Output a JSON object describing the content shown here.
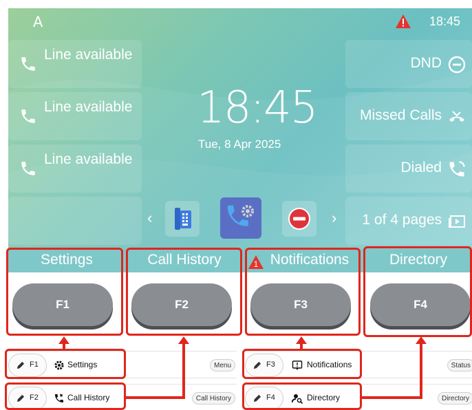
{
  "status_bar": {
    "account": "A",
    "time": "18:45",
    "alert_icon": "warning-triangle-icon"
  },
  "lines": [
    {
      "label": "Line available",
      "icon": "phone-icon"
    },
    {
      "label": "Line available",
      "icon": "phone-icon"
    },
    {
      "label": "Line available",
      "icon": "phone-icon"
    }
  ],
  "clock": {
    "time": "18:45",
    "date": "Tue, 8 Apr 2025"
  },
  "right_keys": [
    {
      "label": "DND",
      "icon": "dnd-circle-icon"
    },
    {
      "label": "Missed Calls",
      "icon": "missed-call-icon"
    },
    {
      "label": "Dialed",
      "icon": "dialed-call-icon"
    },
    {
      "label": "1 of 4 pages",
      "icon": "pages-icon"
    }
  ],
  "dock": {
    "prev": "‹",
    "next": "›",
    "apps": [
      "desk-phone-icon",
      "call-settings-icon",
      "dnd-minus-icon"
    ]
  },
  "softkeys": [
    {
      "label": "Settings",
      "key": "F1"
    },
    {
      "label": "Call History",
      "key": "F2"
    },
    {
      "label": "Notifications",
      "key": "F3",
      "badge": "1"
    },
    {
      "label": "Directory",
      "key": "F4"
    }
  ],
  "config_rows": [
    {
      "key": "F1",
      "label": "Settings",
      "icon": "gear-icon",
      "tag": "Menu"
    },
    {
      "key": "F3",
      "label": "Notifications",
      "icon": "notification-icon",
      "tag": "Status"
    },
    {
      "key": "F2",
      "label": "Call History",
      "icon": "call-history-icon",
      "tag": "Call History"
    },
    {
      "key": "F4",
      "label": "Directory",
      "icon": "directory-icon",
      "tag": "Directory"
    }
  ],
  "colors": {
    "accent": "#7fc8c9",
    "highlight": "#e0261c",
    "softkey": "#8a8e92"
  }
}
